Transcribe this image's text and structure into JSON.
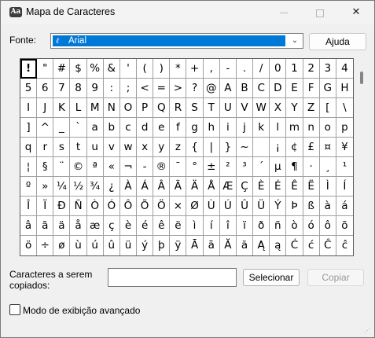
{
  "window": {
    "title": "Mapa de Caracteres",
    "icon": "charmap-app-icon",
    "controls": {
      "minimize": "minimize",
      "maximize": "maximize",
      "close": "✕"
    }
  },
  "font": {
    "label": "Fonte:",
    "selected": "Arial",
    "icon": "opentype-font-icon"
  },
  "buttons": {
    "help": "Ajuda",
    "select": "Selecionar",
    "copy": "Copiar"
  },
  "copy_field": {
    "label": "Caracteres a serem copiados:",
    "value": ""
  },
  "advanced": {
    "label": "Modo de exibição avançado",
    "checked": false
  },
  "grid": {
    "selected_index": 0,
    "rows": [
      [
        "!",
        "\"",
        "#",
        "$",
        "%",
        "&",
        "'",
        "(",
        ")",
        "*",
        "+",
        ",",
        "-",
        ".",
        "/",
        "0",
        "1",
        "2",
        "3",
        "4"
      ],
      [
        "5",
        "6",
        "7",
        "8",
        "9",
        ":",
        ";",
        "<",
        "=",
        ">",
        "?",
        "@",
        "A",
        "B",
        "C",
        "D",
        "E",
        "F",
        "G",
        "H"
      ],
      [
        "I",
        "J",
        "K",
        "L",
        "M",
        "N",
        "O",
        "P",
        "Q",
        "R",
        "S",
        "T",
        "U",
        "V",
        "W",
        "X",
        "Y",
        "Z",
        "[",
        "\\"
      ],
      [
        "]",
        "^",
        "_",
        "`",
        "a",
        "b",
        "c",
        "d",
        "e",
        "f",
        "g",
        "h",
        "i",
        "j",
        "k",
        "l",
        "m",
        "n",
        "o",
        "p"
      ],
      [
        "q",
        "r",
        "s",
        "t",
        "u",
        "v",
        "w",
        "x",
        "y",
        "z",
        "{",
        "|",
        "}",
        "~",
        " ",
        "¡",
        "¢",
        "£",
        "¤",
        "¥"
      ],
      [
        "¦",
        "§",
        "¨",
        "©",
        "ª",
        "«",
        "¬",
        "-",
        "®",
        "¯",
        "°",
        "±",
        "²",
        "³",
        "´",
        "µ",
        "¶",
        "·",
        "¸",
        "¹"
      ],
      [
        "º",
        "»",
        "¼",
        "½",
        "¾",
        "¿",
        "À",
        "Á",
        "Â",
        "Ã",
        "Ä",
        "Å",
        "Æ",
        "Ç",
        "È",
        "É",
        "Ê",
        "Ë",
        "Ì",
        "Í"
      ],
      [
        "Î",
        "Ï",
        "Ð",
        "Ñ",
        "Ò",
        "Ó",
        "Ô",
        "Õ",
        "Ö",
        "×",
        "Ø",
        "Ù",
        "Ú",
        "Û",
        "Ü",
        "Ý",
        "Þ",
        "ß",
        "à",
        "á"
      ],
      [
        "â",
        "ã",
        "ä",
        "å",
        "æ",
        "ç",
        "è",
        "é",
        "ê",
        "ë",
        "ì",
        "í",
        "î",
        "ï",
        "ð",
        "ñ",
        "ò",
        "ó",
        "ô",
        "õ"
      ],
      [
        "ö",
        "÷",
        "ø",
        "ù",
        "ú",
        "û",
        "ü",
        "ý",
        "þ",
        "ÿ",
        "Ā",
        "ā",
        "Ă",
        "ă",
        "Ą",
        "ą",
        "Ć",
        "ć",
        "Ĉ",
        "ĉ"
      ]
    ]
  }
}
